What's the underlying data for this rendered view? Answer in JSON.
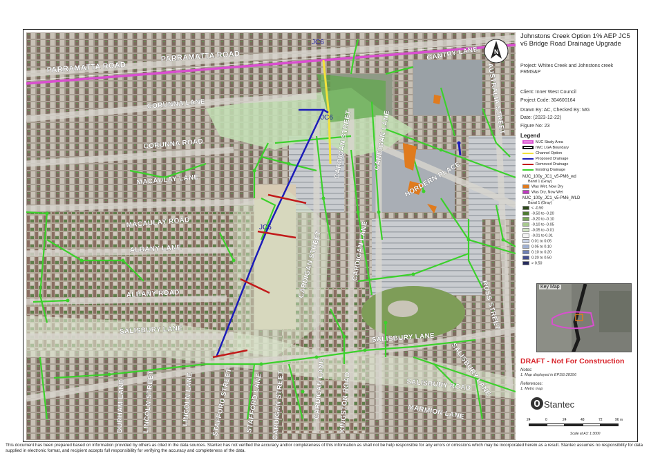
{
  "map": {
    "streets": [
      "PARRAMATTA ROAD",
      "PARRAMATTA ROAD",
      "GANTRY LANE",
      "AUSTRALIA STREET",
      "CORUNNA LANE",
      "CORUNNA ROAD",
      "MACAULAY LANE",
      "MACAULAY ROAD",
      "ALBANY LANE",
      "ALBANY ROAD",
      "SALISBURY LANE",
      "SALISBURY LANE",
      "SALISBURY LANE",
      "SALISBURY ROAD",
      "CARDIGAN STREET",
      "CARDIGAN LANE",
      "CARDIGAN STREET",
      "CARDIGAN LANE",
      "HORDERN PLACE",
      "ROSS STREET",
      "KINGSTON ROAD",
      "CARDIGAN LANE",
      "CARDIGAN STREET",
      "STAFFORD LANE",
      "STAFFORD STREET",
      "LINCOLN LANE",
      "LINCOLN STREET",
      "DURHAM LANE",
      "MARMION LANE"
    ],
    "drainage_labels": [
      "JC6",
      "JC6",
      "JC5"
    ],
    "north_arrow_letter": "N"
  },
  "panel": {
    "title": "Johnstons Creek Option 1% AEP JC5 v6 Bridge Road Drainage Upgrade",
    "project": "Project:  Whites Creek and Johnstons creek FRMS&P",
    "client": "Client:  Inner West Council",
    "project_code": "Project Code:  304600164",
    "drawn_by": "Drawn By:  AC, Checked By: MG",
    "date": "Date:  (2023-12-22)",
    "figure_no": "Figure No:  23",
    "legend_title": "Legend",
    "legend_lines": [
      {
        "label": "MJC Study Area",
        "color": "#d94fd0"
      },
      {
        "label": "IWC LGA Boundary",
        "color": "#111111"
      },
      {
        "label": "Channel Option",
        "color": "#f2e23a"
      },
      {
        "label": "Proposed Drainage",
        "color": "#1c1cb8"
      },
      {
        "label": "Removed Drainage",
        "color": "#c21a1a"
      },
      {
        "label": "Existing Drainage",
        "color": "#3bd12b"
      }
    ],
    "wd_layer": "MJC_100y_JC1_v5-PM6_wd",
    "band1": "Band 1 (Gray)",
    "wd_classes": [
      {
        "label": "Was Wet, Now Dry",
        "color": "#e07b1e"
      },
      {
        "label": "Was Dry, Now Wet",
        "color": "#c03ac0"
      }
    ],
    "wld_layer": "MJC_100y_JC1_v5-PM6_WLD",
    "band1_b": "Band 1 (Gray)",
    "wld_classes": [
      {
        "label": "< -0.50",
        "color": "#2f4a1c"
      },
      {
        "label": "-0.50 to -0.20",
        "color": "#4e7a32"
      },
      {
        "label": "-0.20 to -0.10",
        "color": "#78a558"
      },
      {
        "label": "-0.10 to -0.05",
        "color": "#a7c98e"
      },
      {
        "label": "-0.05 to -0.01",
        "color": "#d3e6c5"
      },
      {
        "label": "-0.01 to 0.01",
        "color": "#f4f4f4"
      },
      {
        "label": "0.01 to 0.05",
        "color": "#cdd6e8"
      },
      {
        "label": "0.05 to 0.10",
        "color": "#9fb0d2"
      },
      {
        "label": "0.10 to 0.20",
        "color": "#6f80b5"
      },
      {
        "label": "0.20 to 0.50",
        "color": "#444f8e"
      },
      {
        "label": "> 0.50",
        "color": "#262b5e"
      }
    ],
    "key_map": "Key Map",
    "draft": "DRAFT - Not For Construction",
    "notes_title": "Notes:",
    "notes": "1. Map displayed in EPSG:28356",
    "references_title": "References:",
    "references": "1. Metro map",
    "brand": "Stantec",
    "scale_ticks": [
      "24",
      "0",
      "24",
      "48",
      "72",
      "96 m"
    ],
    "scale_text": "Scale at A3: 1:3000"
  },
  "disclaimer": "This document has been prepared based on information provided by others as cited in the data sources. Stantec has not verified the accuracy and/or completeness of this information as shall not be help responsible for any errors or omissions which may be incorporated herein as a result. Stantec assumes no responsibility for data supplied in electronic format, and recipient accepts full responsibility for verifying the accuracy and completeness of the data."
}
